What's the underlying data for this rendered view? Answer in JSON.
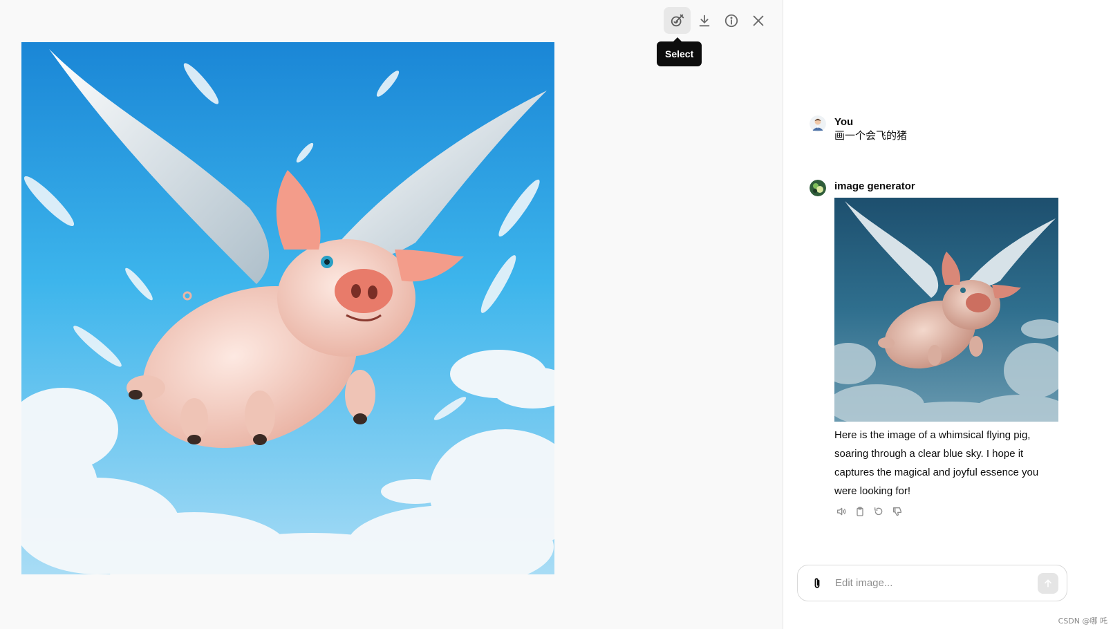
{
  "toolbar": {
    "buttons": [
      {
        "icon": "select-brush-icon",
        "label": "Select"
      },
      {
        "icon": "download-icon"
      },
      {
        "icon": "info-icon"
      },
      {
        "icon": "close-icon"
      }
    ],
    "tooltip": "Select"
  },
  "viewer": {
    "image_subject": "flying-pig-illustration"
  },
  "chat": {
    "user": {
      "name": "You",
      "text": "画一个会飞的猪"
    },
    "bot": {
      "name": "image generator",
      "text": "Here is the image of a whimsical flying pig, soaring through a clear blue sky. I hope it captures the magical and joyful essence you were looking for!",
      "actions": [
        "read-aloud-icon",
        "copy-icon",
        "regenerate-icon",
        "thumbs-down-icon"
      ]
    },
    "composer": {
      "placeholder": "Edit image..."
    }
  },
  "watermark": "CSDN @哪 吒",
  "colors": {
    "sky_top": "#1e88d8",
    "sky_mid": "#3fb3ea",
    "sky_bottom": "#bfe6f7",
    "pig_body": "#f6d2c6",
    "pig_ear": "#f08a78",
    "wing": "#eef3f6"
  }
}
